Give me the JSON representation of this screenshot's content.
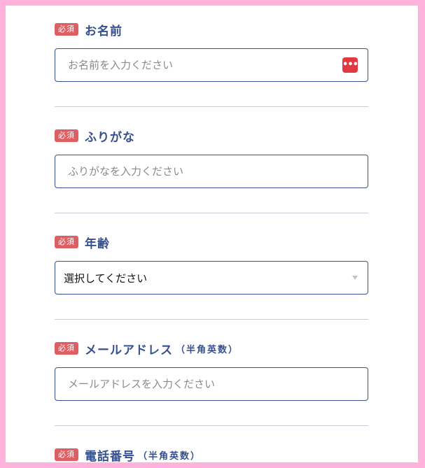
{
  "form": {
    "required_badge": "必須",
    "name": {
      "label": "お名前",
      "placeholder": "お名前を入力ください",
      "autofill_icon": "password-manager-icon"
    },
    "furigana": {
      "label": "ふりがな",
      "placeholder": "ふりがなを入力ください"
    },
    "age": {
      "label": "年齢",
      "selected": "選択してください"
    },
    "email": {
      "label": "メールアドレス",
      "note": "（半角英数）",
      "placeholder": "メールアドレスを入力ください"
    },
    "phone": {
      "label": "電話番号",
      "note": "（半角英数）"
    }
  },
  "colors": {
    "frame": "#ffb3dc",
    "label": "#36508f",
    "badge": "#dc5f63",
    "border": "#3a538c"
  }
}
